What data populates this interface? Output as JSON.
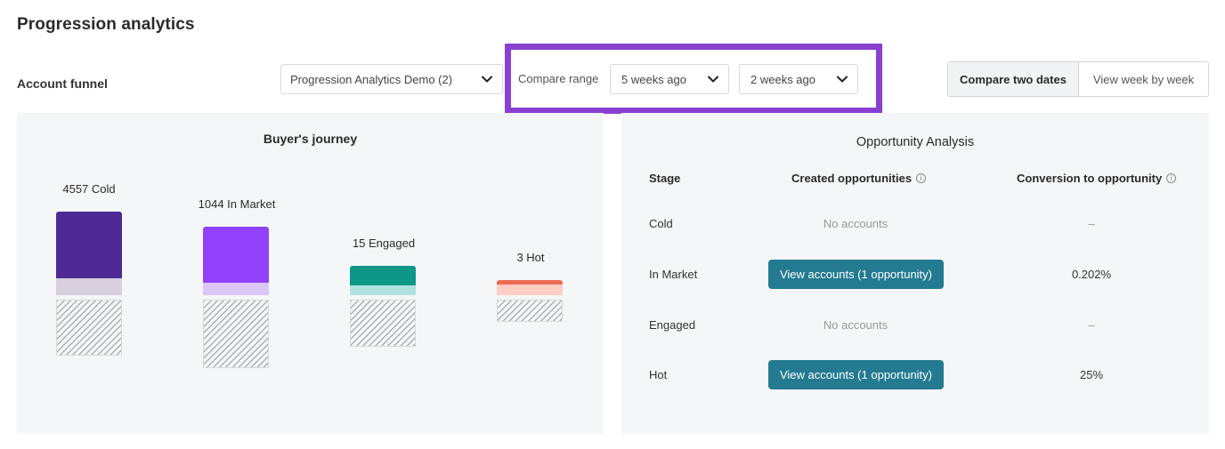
{
  "header": {
    "title": "Progression analytics",
    "funnel_label": "Account funnel"
  },
  "filters": {
    "dataset_value": "Progression Analytics Demo (2)",
    "compare_label": "Compare range",
    "from_value": "5 weeks ago",
    "to_value": "2 weeks ago"
  },
  "view_toggle": {
    "compare_two_dates": "Compare two dates",
    "view_week_by_week": "View week by week",
    "active": "compare_two_dates"
  },
  "colors": {
    "highlight": "#8a3fd1",
    "cold": "#4f2a96",
    "cold_light": "#d8d0dc",
    "in_market": "#9142fa",
    "in_market_light": "#dcc6f7",
    "engaged": "#0e9688",
    "engaged_light": "#b2e2df",
    "hot": "#ec6a55",
    "hot_light": "#fccdc3",
    "button": "#237a91"
  },
  "buyers_journey": {
    "title": "Buyer's journey",
    "bars": [
      {
        "label": "4557 Cold",
        "count": 4557,
        "stage": "cold"
      },
      {
        "label": "1044 In Market",
        "count": 1044,
        "stage": "in_market"
      },
      {
        "label": "15 Engaged",
        "count": 15,
        "stage": "engaged"
      },
      {
        "label": "3 Hot",
        "count": 3,
        "stage": "hot"
      }
    ]
  },
  "opportunity_analysis": {
    "title": "Opportunity Analysis",
    "headers": {
      "stage": "Stage",
      "created": "Created opportunities",
      "conversion": "Conversion to opportunity"
    },
    "rows": [
      {
        "stage": "Cold",
        "created": "No accounts",
        "conversion": "–"
      },
      {
        "stage": "In Market",
        "created_button": "View accounts (1 opportunity)",
        "conversion": "0.202%"
      },
      {
        "stage": "Engaged",
        "created": "No accounts",
        "conversion": "–"
      },
      {
        "stage": "Hot",
        "created_button": "View accounts (1 opportunity)",
        "conversion": "25%"
      }
    ]
  }
}
